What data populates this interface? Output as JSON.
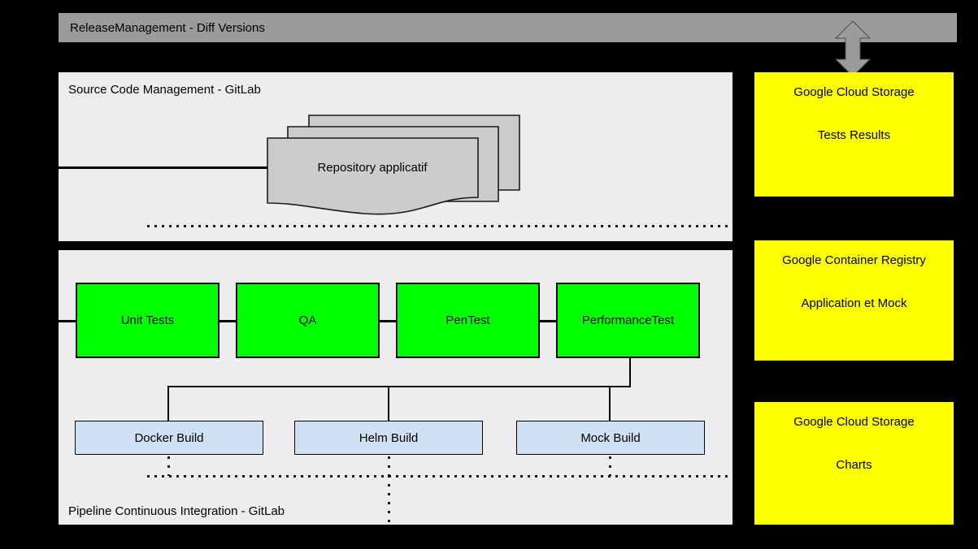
{
  "diagram": {
    "title_bar": {
      "label": "ReleaseManagement - Diff Versions",
      "fill": "#9b9b9b"
    },
    "panels": [
      {
        "name": "source-code-management",
        "label": "Source Code Management - GitLab",
        "fill": "#ededed"
      },
      {
        "name": "pipeline-continuous-integration",
        "label": "Pipeline Continuous Integration - GitLab",
        "fill": "#ededed"
      }
    ],
    "repository": {
      "label": "Repository applicatif",
      "fill": "#cccccc",
      "stack_count": 3
    },
    "test_stages": [
      {
        "label": "Unit Tests",
        "fill": "#00ff00"
      },
      {
        "label": "QA",
        "fill": "#00ff00"
      },
      {
        "label": "PenTest",
        "fill": "#00ff00"
      },
      {
        "label": "PerformanceTest",
        "fill": "#00ff00"
      }
    ],
    "build_stages": [
      {
        "label": "Docker Build",
        "fill": "#cfe0f3"
      },
      {
        "label": "Helm Build",
        "fill": "#cfe0f3"
      },
      {
        "label": "Mock Build",
        "fill": "#cfe0f3"
      }
    ],
    "storage_boxes": [
      {
        "name": "google-cloud-storage-tests-results",
        "line1": "Google Cloud Storage",
        "line2": "Tests Results",
        "fill": "#ffff00"
      },
      {
        "name": "google-container-registry",
        "line1": "Google Container Registry",
        "line2": "Application et Mock",
        "fill": "#ffff00"
      },
      {
        "name": "google-cloud-storage-charts",
        "line1": "Google Cloud Storage",
        "line2": "Charts",
        "fill": "#ffff00"
      }
    ],
    "connector_arrow": {
      "name": "bidirectional-arrow",
      "fill": "#9b9b9b",
      "direction": "both"
    },
    "background": "#000000"
  }
}
